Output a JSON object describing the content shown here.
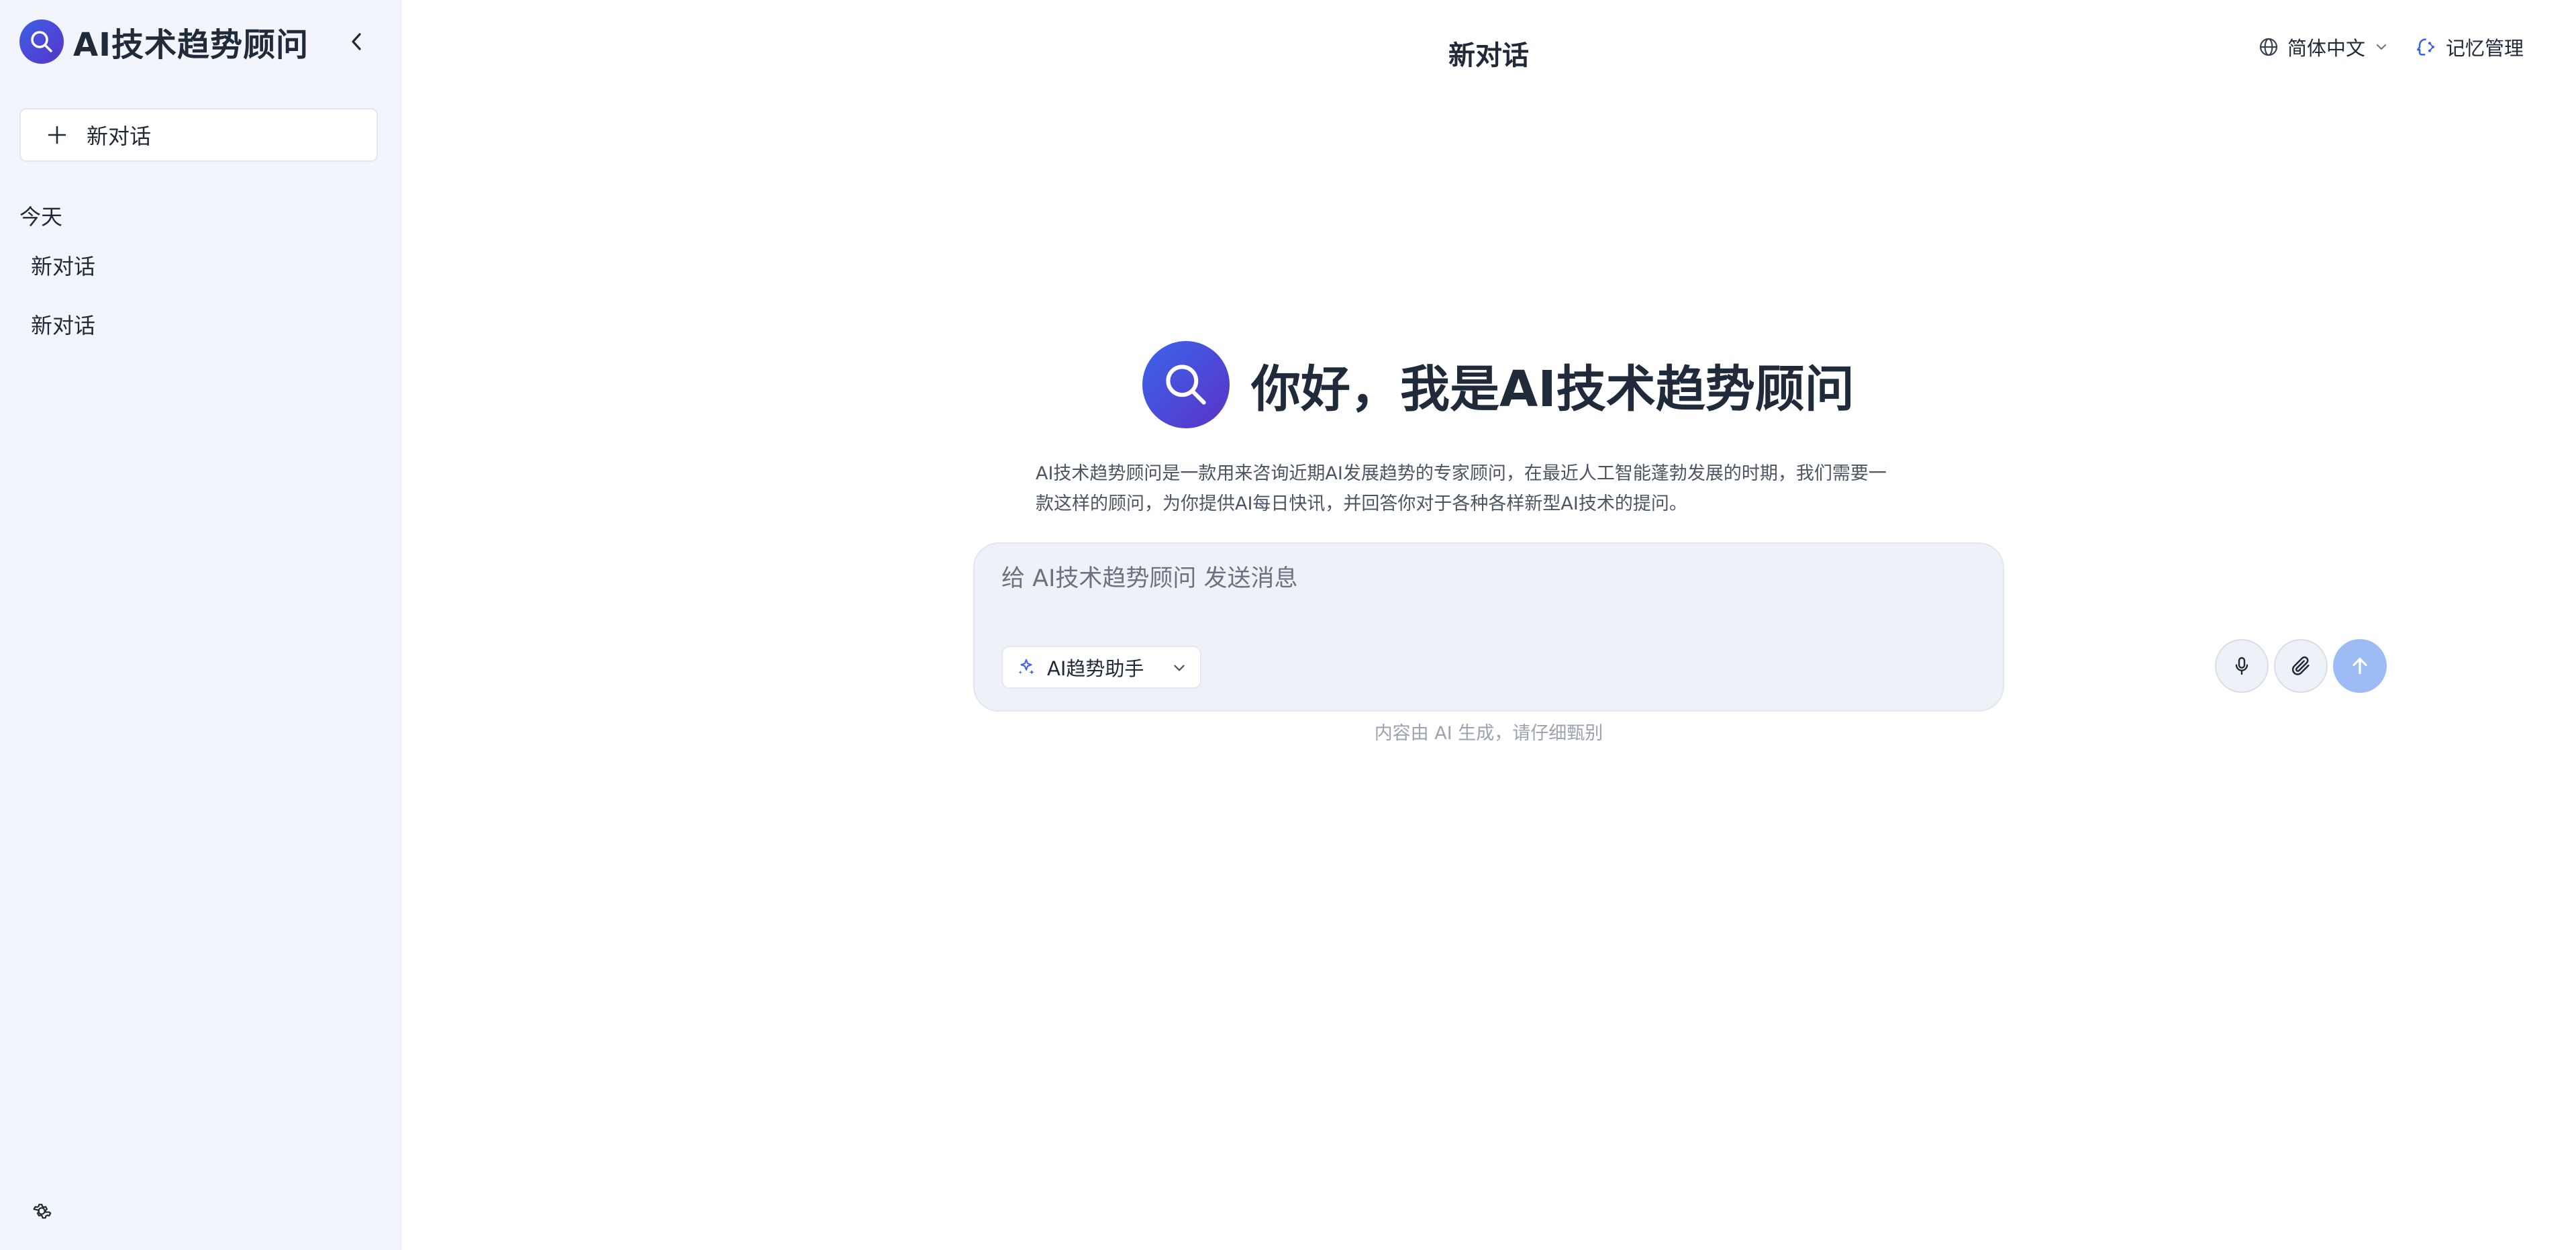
{
  "sidebar": {
    "app_title": "AI技术趋势顾问",
    "new_chat_label": "新对话",
    "section_today": "今天",
    "history": [
      {
        "label": "新对话"
      },
      {
        "label": "新对话"
      }
    ]
  },
  "header": {
    "page_title": "新对话",
    "language": "简体中文",
    "memory": "记忆管理"
  },
  "hero": {
    "title": "你好，我是AI技术趋势顾问",
    "description_line1": "AI技术趋势顾问是一款用来咨询近期AI发展趋势的专家顾问，在最近人工智能蓬勃发展的时期，我们需要一",
    "description_line2": "款这样的顾问，为你提供AI每日快讯，并回答你对于各种各样新型AI技术的提问。"
  },
  "composer": {
    "placeholder": "给 AI技术趋势顾问 发送消息",
    "value": "",
    "agent": "AI趋势助手"
  },
  "footer": {
    "disclaimer": "内容由 AI 生成，请仔细甄别"
  },
  "colors": {
    "accent": "#3a62e6",
    "accent_dark": "#5a33c9",
    "send_disabled": "#9dbcf5",
    "sidebar_bg": "#f2f6fc"
  },
  "icons": {
    "logo": "search-icon",
    "collapse": "chevron-left-icon",
    "new_chat": "plus-icon",
    "settings": "gear-icon",
    "language": "globe-icon",
    "memory": "memory-icon",
    "agent": "sparkle-icon",
    "mic": "mic-icon",
    "attach": "paperclip-icon",
    "send": "arrow-up-icon"
  }
}
